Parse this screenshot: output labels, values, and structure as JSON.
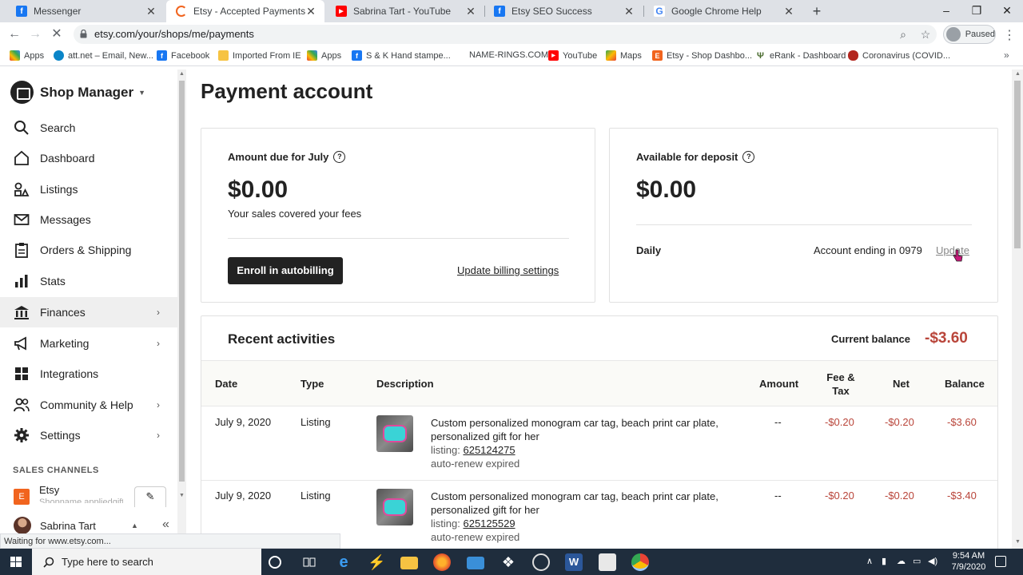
{
  "browser": {
    "tabs": [
      {
        "label": "Messenger",
        "icon": "facebook-icon",
        "color": "#1877f2"
      },
      {
        "label": "Etsy - Accepted Payments",
        "icon": "loading-icon",
        "color": "#f1641e"
      },
      {
        "label": "Sabrina Tart - YouTube",
        "icon": "youtube-icon",
        "color": "#ff0000"
      },
      {
        "label": "Etsy SEO Success",
        "icon": "facebook-icon",
        "color": "#1877f2"
      },
      {
        "label": "Google Chrome Help",
        "icon": "google-icon",
        "color": "#4285f4"
      }
    ],
    "url": "etsy.com/your/shops/me/payments",
    "profile_status": "Paused",
    "bookmarks": [
      "Apps",
      "att.net – Email, New...",
      "Facebook",
      "Imported From IE",
      "Apps",
      "S & K Hand stampe...",
      "NAME-RINGS.COM",
      "YouTube",
      "Maps",
      "Etsy - Shop Dashbo...",
      "eRank - Dashboard",
      "Coronavirus (COVID..."
    ],
    "status_text": "Waiting for www.etsy.com..."
  },
  "sidebar": {
    "title": "Shop Manager",
    "items": [
      {
        "label": "Search",
        "icon": "search-icon"
      },
      {
        "label": "Dashboard",
        "icon": "home-icon"
      },
      {
        "label": "Listings",
        "icon": "listings-icon"
      },
      {
        "label": "Messages",
        "icon": "mail-icon"
      },
      {
        "label": "Orders & Shipping",
        "icon": "clipboard-icon"
      },
      {
        "label": "Stats",
        "icon": "bar-chart-icon"
      },
      {
        "label": "Finances",
        "icon": "bank-icon"
      },
      {
        "label": "Marketing",
        "icon": "megaphone-icon"
      },
      {
        "label": "Integrations",
        "icon": "grid-icon"
      },
      {
        "label": "Community & Help",
        "icon": "people-icon"
      },
      {
        "label": "Settings",
        "icon": "gear-icon"
      }
    ],
    "sales_channels_header": "SALES CHANNELS",
    "channel": {
      "name": "Etsy",
      "sub": "Shopname appliedgifts"
    },
    "user": "Sabrina Tart"
  },
  "main": {
    "title": "Payment account",
    "amount_due": {
      "label": "Amount due for July",
      "amount": "$0.00",
      "note": "Your sales covered your fees",
      "enroll_button": "Enroll in autobilling",
      "billing_link": "Update billing settings"
    },
    "available": {
      "label": "Available for deposit",
      "amount": "$0.00",
      "schedule": "Daily",
      "account": "Account ending in 0979",
      "update_link": "Update"
    },
    "activities": {
      "title": "Recent activities",
      "balance_label": "Current balance",
      "balance_value": "-$3.60",
      "columns": {
        "date": "Date",
        "type": "Type",
        "description": "Description",
        "amount": "Amount",
        "fee_tax": "Fee & Tax",
        "net": "Net",
        "balance": "Balance"
      },
      "rows": [
        {
          "date": "July 9, 2020",
          "type": "Listing",
          "title": "Custom personalized monogram car tag, beach print car plate, personalized gift for her",
          "listing_label": "listing:",
          "listing_id": "625124275",
          "status": "auto-renew expired",
          "amount": "--",
          "fee": "-$0.20",
          "net": "-$0.20",
          "balance": "-$3.60"
        },
        {
          "date": "July 9, 2020",
          "type": "Listing",
          "title": "Custom personalized monogram car tag, beach print car plate, personalized gift for her",
          "listing_label": "listing:",
          "listing_id": "625125529",
          "status": "auto-renew expired",
          "amount": "--",
          "fee": "-$0.20",
          "net": "-$0.20",
          "balance": "-$3.40"
        }
      ]
    }
  },
  "taskbar": {
    "search_placeholder": "Type here to search",
    "time": "9:54 AM",
    "date": "7/9/2020"
  },
  "colors": {
    "negative": "#b9453a",
    "dark_button": "#222222",
    "active_nav": "#efefef"
  }
}
